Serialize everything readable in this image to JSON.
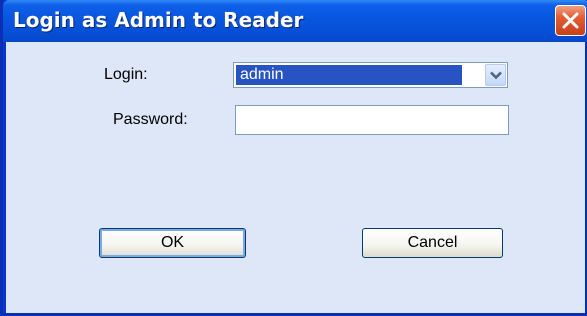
{
  "window": {
    "title": "Login as Admin to Reader"
  },
  "form": {
    "login_label": "Login:",
    "login_value": "admin",
    "password_label": "Password:",
    "password_value": ""
  },
  "buttons": {
    "ok_label": "OK",
    "cancel_label": "Cancel"
  },
  "colors": {
    "title_bar": "#0855dd",
    "client_background": "#dde7f7",
    "selection_highlight": "#2754c2",
    "close_button": "#e35d32"
  },
  "icons": {
    "close": "close-icon",
    "dropdown": "chevron-down-icon"
  }
}
